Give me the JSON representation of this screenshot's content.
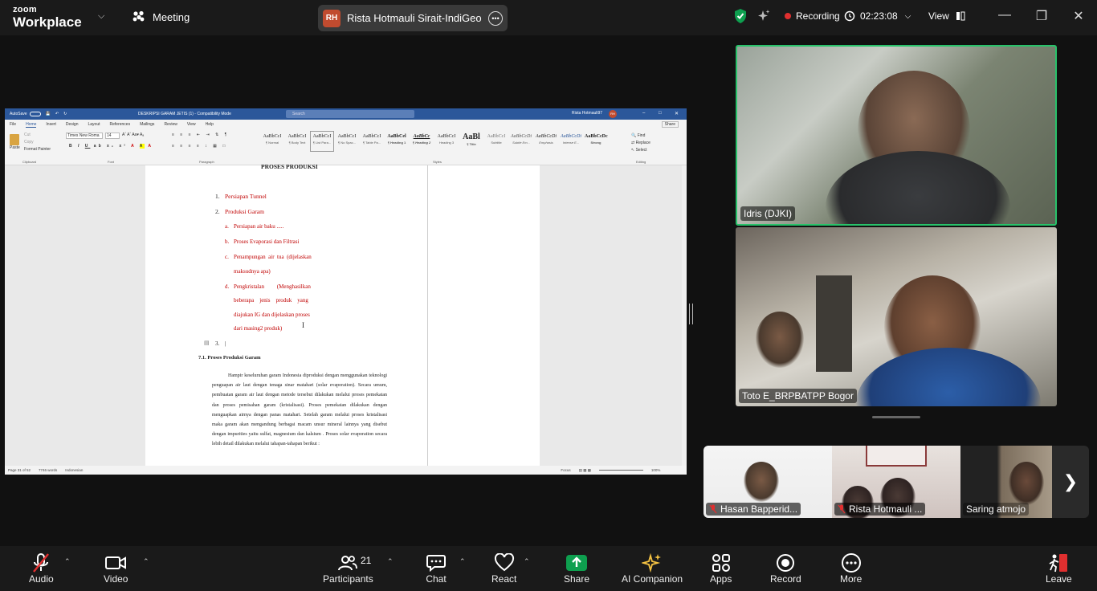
{
  "topbar": {
    "brand_line1": "zoom",
    "brand_line2": "Workplace",
    "meeting_label": "Meeting",
    "share_initials": "RH",
    "share_name": "Rista Hotmauli Sirait-IndiGeo's sc",
    "recording_label": "Recording",
    "timer": "02:23:08",
    "view_label": "View"
  },
  "document": {
    "title": "DESKRIPSI GARAM JETIS (1) - Compatibility Mode",
    "autosave": "AutoSave",
    "search_placeholder": "Search",
    "user": "Rista Hotmauli97",
    "user_initials": "RH",
    "share_btn": "Share",
    "menu": [
      "File",
      "Home",
      "Insert",
      "Design",
      "Layout",
      "References",
      "Mailings",
      "Review",
      "View",
      "Help"
    ],
    "font_name": "Times New Roma",
    "font_size": "14",
    "clipboard": [
      "Cut",
      "Copy",
      "Format Painter",
      "Paste"
    ],
    "editing": [
      "Find",
      "Replace",
      "Select"
    ],
    "group_labels": [
      "Clipboard",
      "Font",
      "Paragraph",
      "Styles",
      "Editing"
    ],
    "styles": [
      {
        "sample": "AaBbCcI",
        "name": "¶ Normal"
      },
      {
        "sample": "AaBbCcI",
        "name": "¶ Body Text"
      },
      {
        "sample": "AaBbCcI",
        "name": "¶ List Para..."
      },
      {
        "sample": "AaBbCcI",
        "name": "¶ No Spac..."
      },
      {
        "sample": "AaBbCcI",
        "name": "¶ Table Pa..."
      },
      {
        "sample": "AaBbCel",
        "name": "¶ Heading 1"
      },
      {
        "sample": "AaBbCc",
        "name": "¶ Heading 2"
      },
      {
        "sample": "AaBbCcI",
        "name": "Heading 3"
      },
      {
        "sample": "AaBl",
        "name": "¶ Title"
      },
      {
        "sample": "AaBbCcI",
        "name": "Subtitle"
      },
      {
        "sample": "AaBbCcDi",
        "name": "Subtle Em..."
      },
      {
        "sample": "AaBbCcDi",
        "name": "Emphasis"
      },
      {
        "sample": "AaBbCcDi",
        "name": "Intense E..."
      },
      {
        "sample": "AaBbCcDc",
        "name": "Strong"
      }
    ],
    "heading": "PROSES PRODUKSI",
    "list1": "Persiapan Tunnel",
    "list2": "Produksi Garam",
    "sub_a": "Persiapan air baku .....",
    "sub_b": "Proses Evaporasi dan Filtrasi",
    "sub_c1": "Penampungan  air  tua  (dijelaskan",
    "sub_c2": "maksudnya apa)",
    "sub_d1": "Pengkristalan         (Menghasilkan",
    "sub_d2": "beberapa    jenis    produk    yang",
    "sub_d3": "diajukan IG dan dijelaskan proses",
    "sub_d4": "dari masing2 produk)",
    "list3": "3.",
    "section": "7.1. Proses Produksi Garam",
    "paragraph": "Hampir keseluruhan garam Indonesia diproduksi dengan menggunakan teknologi penguapan air laut dengan tenaga sinar matahari (solar evaporation). Secara umum, pembuatan garam air laut dengan metode tersebut dilakukan melalui proses pemekatan dan proses pemisahan garam (kristalisasi). Proses pemekatan dilakukan dengan menguapkan airnya dengan panas matahari. Setelah garam melalui proses kristalisasi maka garam akan mengandung berbagai macam unsur mineral lainnya yang disebut dengan impurities yaitu sulfat, magnesium dan kalsium . Proses solar evaporation secara lebih detail dilakukan melalui tahapan-tahapan berikut :",
    "status_page": "Page 31 of 52",
    "status_words": "7746 words",
    "status_lang": "Indonesian",
    "status_focus": "Focus",
    "zoom_level": "100%"
  },
  "participants": {
    "idris": "Idris (DJKI)",
    "toto": "Toto E_BRPBATPP Bogor",
    "thumbs": [
      "Hasan Bapperid...",
      "Rista Hotmauli ...",
      "Saring atmojo"
    ]
  },
  "toolbar": {
    "audio": "Audio",
    "video": "Video",
    "participants": "Participants",
    "participant_count": "21",
    "chat": "Chat",
    "react": "React",
    "share": "Share",
    "ai": "AI Companion",
    "apps": "Apps",
    "record": "Record",
    "more": "More",
    "leave": "Leave"
  },
  "colors": {
    "share_green": "#0e9f4f",
    "record_red": "#e02f2f",
    "active_speaker": "#28c26a",
    "word_blue": "#2b579a"
  }
}
